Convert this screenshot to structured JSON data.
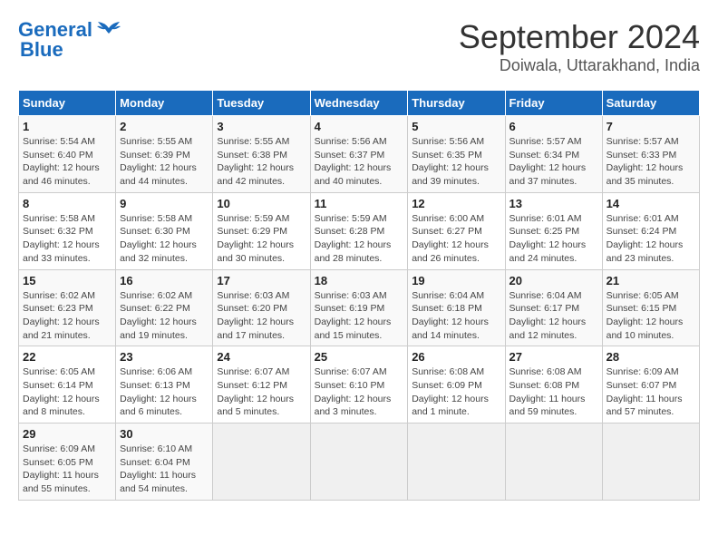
{
  "header": {
    "logo_general": "General",
    "logo_blue": "Blue",
    "title": "September 2024",
    "subtitle": "Doiwala, Uttarakhand, India"
  },
  "calendar": {
    "days_of_week": [
      "Sunday",
      "Monday",
      "Tuesday",
      "Wednesday",
      "Thursday",
      "Friday",
      "Saturday"
    ],
    "weeks": [
      [
        {
          "day": "1",
          "sunrise": "5:54 AM",
          "sunset": "6:40 PM",
          "daylight": "12 hours and 46 minutes."
        },
        {
          "day": "2",
          "sunrise": "5:55 AM",
          "sunset": "6:39 PM",
          "daylight": "12 hours and 44 minutes."
        },
        {
          "day": "3",
          "sunrise": "5:55 AM",
          "sunset": "6:38 PM",
          "daylight": "12 hours and 42 minutes."
        },
        {
          "day": "4",
          "sunrise": "5:56 AM",
          "sunset": "6:37 PM",
          "daylight": "12 hours and 40 minutes."
        },
        {
          "day": "5",
          "sunrise": "5:56 AM",
          "sunset": "6:35 PM",
          "daylight": "12 hours and 39 minutes."
        },
        {
          "day": "6",
          "sunrise": "5:57 AM",
          "sunset": "6:34 PM",
          "daylight": "12 hours and 37 minutes."
        },
        {
          "day": "7",
          "sunrise": "5:57 AM",
          "sunset": "6:33 PM",
          "daylight": "12 hours and 35 minutes."
        }
      ],
      [
        {
          "day": "8",
          "sunrise": "5:58 AM",
          "sunset": "6:32 PM",
          "daylight": "12 hours and 33 minutes."
        },
        {
          "day": "9",
          "sunrise": "5:58 AM",
          "sunset": "6:30 PM",
          "daylight": "12 hours and 32 minutes."
        },
        {
          "day": "10",
          "sunrise": "5:59 AM",
          "sunset": "6:29 PM",
          "daylight": "12 hours and 30 minutes."
        },
        {
          "day": "11",
          "sunrise": "5:59 AM",
          "sunset": "6:28 PM",
          "daylight": "12 hours and 28 minutes."
        },
        {
          "day": "12",
          "sunrise": "6:00 AM",
          "sunset": "6:27 PM",
          "daylight": "12 hours and 26 minutes."
        },
        {
          "day": "13",
          "sunrise": "6:01 AM",
          "sunset": "6:25 PM",
          "daylight": "12 hours and 24 minutes."
        },
        {
          "day": "14",
          "sunrise": "6:01 AM",
          "sunset": "6:24 PM",
          "daylight": "12 hours and 23 minutes."
        }
      ],
      [
        {
          "day": "15",
          "sunrise": "6:02 AM",
          "sunset": "6:23 PM",
          "daylight": "12 hours and 21 minutes."
        },
        {
          "day": "16",
          "sunrise": "6:02 AM",
          "sunset": "6:22 PM",
          "daylight": "12 hours and 19 minutes."
        },
        {
          "day": "17",
          "sunrise": "6:03 AM",
          "sunset": "6:20 PM",
          "daylight": "12 hours and 17 minutes."
        },
        {
          "day": "18",
          "sunrise": "6:03 AM",
          "sunset": "6:19 PM",
          "daylight": "12 hours and 15 minutes."
        },
        {
          "day": "19",
          "sunrise": "6:04 AM",
          "sunset": "6:18 PM",
          "daylight": "12 hours and 14 minutes."
        },
        {
          "day": "20",
          "sunrise": "6:04 AM",
          "sunset": "6:17 PM",
          "daylight": "12 hours and 12 minutes."
        },
        {
          "day": "21",
          "sunrise": "6:05 AM",
          "sunset": "6:15 PM",
          "daylight": "12 hours and 10 minutes."
        }
      ],
      [
        {
          "day": "22",
          "sunrise": "6:05 AM",
          "sunset": "6:14 PM",
          "daylight": "12 hours and 8 minutes."
        },
        {
          "day": "23",
          "sunrise": "6:06 AM",
          "sunset": "6:13 PM",
          "daylight": "12 hours and 6 minutes."
        },
        {
          "day": "24",
          "sunrise": "6:07 AM",
          "sunset": "6:12 PM",
          "daylight": "12 hours and 5 minutes."
        },
        {
          "day": "25",
          "sunrise": "6:07 AM",
          "sunset": "6:10 PM",
          "daylight": "12 hours and 3 minutes."
        },
        {
          "day": "26",
          "sunrise": "6:08 AM",
          "sunset": "6:09 PM",
          "daylight": "12 hours and 1 minute."
        },
        {
          "day": "27",
          "sunrise": "6:08 AM",
          "sunset": "6:08 PM",
          "daylight": "11 hours and 59 minutes."
        },
        {
          "day": "28",
          "sunrise": "6:09 AM",
          "sunset": "6:07 PM",
          "daylight": "11 hours and 57 minutes."
        }
      ],
      [
        {
          "day": "29",
          "sunrise": "6:09 AM",
          "sunset": "6:05 PM",
          "daylight": "11 hours and 55 minutes."
        },
        {
          "day": "30",
          "sunrise": "6:10 AM",
          "sunset": "6:04 PM",
          "daylight": "11 hours and 54 minutes."
        },
        null,
        null,
        null,
        null,
        null
      ]
    ]
  }
}
